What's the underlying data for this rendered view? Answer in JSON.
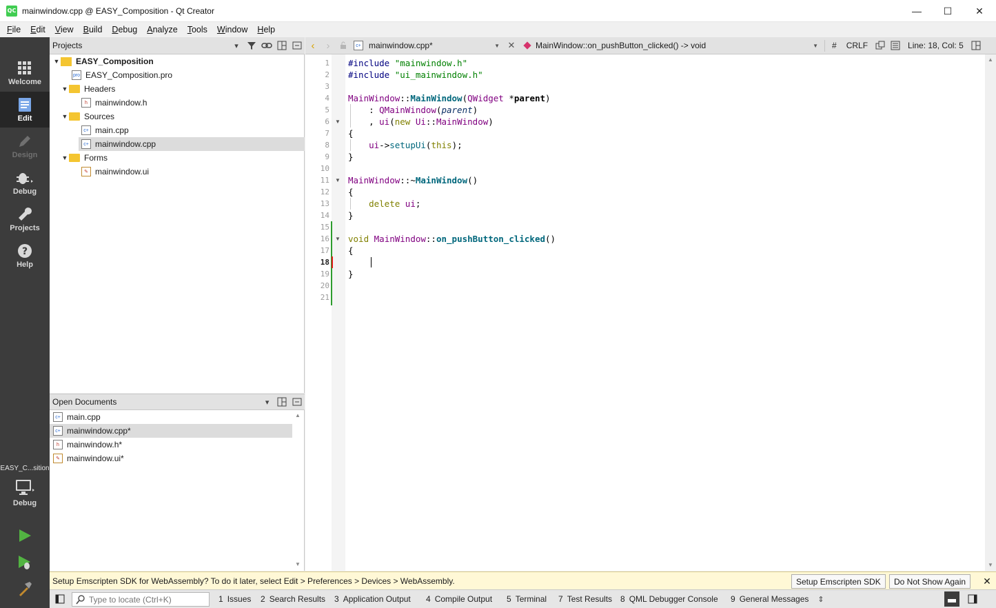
{
  "window": {
    "icon_text": "QC",
    "title": "mainwindow.cpp @ EASY_Composition - Qt Creator",
    "minimize": "—",
    "maximize": "☐",
    "close": "✕"
  },
  "menu": [
    {
      "key": "F",
      "rest": "ile"
    },
    {
      "key": "E",
      "rest": "dit"
    },
    {
      "key": "V",
      "rest": "iew"
    },
    {
      "key": "B",
      "rest": "uild"
    },
    {
      "key": "D",
      "rest": "ebug"
    },
    {
      "key": "A",
      "rest": "nalyze"
    },
    {
      "key": "T",
      "rest": "ools"
    },
    {
      "key": "W",
      "rest": "indow"
    },
    {
      "key": "H",
      "rest": "elp"
    }
  ],
  "modes": {
    "welcome": "Welcome",
    "edit": "Edit",
    "design": "Design",
    "debug": "Debug",
    "projects": "Projects",
    "help": "Help",
    "kit_name": "EASY_C...sition",
    "kit_mode": "Debug"
  },
  "projects_pane": {
    "title": "Projects",
    "tree": [
      {
        "label": "EASY_Composition",
        "icon": "project-icon"
      },
      {
        "label": "EASY_Composition.pro",
        "icon": "pro-file-icon"
      },
      {
        "label": "Headers",
        "icon": "folder-icon"
      },
      {
        "label": "mainwindow.h",
        "icon": "header-file-icon"
      },
      {
        "label": "Sources",
        "icon": "folder-icon"
      },
      {
        "label": "main.cpp",
        "icon": "cpp-file-icon"
      },
      {
        "label": "mainwindow.cpp",
        "icon": "cpp-file-icon"
      },
      {
        "label": "Forms",
        "icon": "folder-icon"
      },
      {
        "label": "mainwindow.ui",
        "icon": "ui-file-icon"
      }
    ]
  },
  "open_documents": {
    "title": "Open Documents",
    "items": [
      "main.cpp",
      "mainwindow.cpp*",
      "mainwindow.h*",
      "mainwindow.ui*"
    ]
  },
  "editor_toolbar": {
    "file": "mainwindow.cpp*",
    "function": "MainWindow::on_pushButton_clicked() -> void",
    "hash": "#",
    "line_ending": "CRLF",
    "position": "Line: 18, Col: 5"
  },
  "editor": {
    "line_numbers": [
      "1",
      "2",
      "3",
      "4",
      "5",
      "6",
      "7",
      "8",
      "9",
      "10",
      "11",
      "12",
      "13",
      "14",
      "15",
      "16",
      "17",
      "18",
      "19",
      "20",
      "21"
    ],
    "current_line": 18
  },
  "infobar": {
    "message": "Setup Emscripten SDK for WebAssembly? To do it later, select Edit > Preferences > Devices > WebAssembly.",
    "setup_button": "Setup Emscripten SDK",
    "dismiss_button": "Do Not Show Again"
  },
  "statusbar": {
    "locator_placeholder": "Type to locate (Ctrl+K)",
    "tabs": [
      {
        "num": "1",
        "label": "Issues"
      },
      {
        "num": "2",
        "label": "Search Results"
      },
      {
        "num": "3",
        "label": "Application Output"
      },
      {
        "num": "4",
        "label": "Compile Output"
      },
      {
        "num": "5",
        "label": "Terminal"
      },
      {
        "num": "7",
        "label": "Test Results"
      },
      {
        "num": "8",
        "label": "QML Debugger Console"
      },
      {
        "num": "9",
        "label": "General Messages"
      }
    ]
  },
  "colors": {
    "modebar": "#3c3c3c",
    "accent_green": "#41cd52",
    "change_marker": "#2e9c2e"
  }
}
